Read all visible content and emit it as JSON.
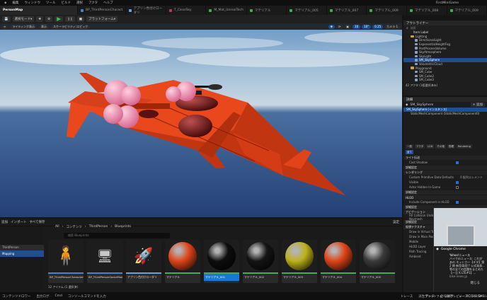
{
  "menu": [
    "編集",
    "ウィンドウ",
    "ツール",
    "ビルド",
    "選択",
    "アクタ",
    "ヘルプ"
  ],
  "project_name": "FirstMiniGame",
  "level_name": "PersonMap",
  "tabs": [
    {
      "label": "BP_ThirdPersonCharact",
      "color": "#4a7fd4"
    },
    {
      "label": "アプリン色付けローダリ",
      "color": "#6aa0e0"
    },
    {
      "label": "T_ClearSky",
      "color": "#c0364b"
    },
    {
      "label": "M_Mat_UnrealTech",
      "color": "#3fae5a"
    },
    {
      "label": "マテリアル",
      "color": "#3fae5a"
    },
    {
      "label": "マテリアル_005",
      "color": "#3fae5a"
    },
    {
      "label": "マテリアル_007",
      "color": "#3fae5a"
    },
    {
      "label": "マテリアル_009",
      "color": "#3fae5a"
    },
    {
      "label": "マテリアル_008",
      "color": "#3fae5a"
    },
    {
      "label": "マテリアル_009",
      "color": "#3fae5a"
    }
  ],
  "toolbar": {
    "mode": "選択モード",
    "platforms": "プラットフォーム"
  },
  "viewport": {
    "left": [
      "ライティング表示",
      "表示",
      "スケーラビリティ:エピック"
    ],
    "right": [
      "10",
      "10°",
      "0.25",
      "カメラ 1"
    ],
    "label": "プラットフォームのプレビュー: PC D3D SM5"
  },
  "outliner": {
    "title": "アウトライナー",
    "search": "検索",
    "column": "Item Label",
    "items": [
      {
        "label": "Lighting",
        "type": "folder",
        "indent": 1,
        "selected": false
      },
      {
        "label": "DirectionalLight",
        "type": "obj",
        "indent": 2,
        "selected": false
      },
      {
        "label": "ExponentialHeightFog",
        "type": "obj",
        "indent": 2,
        "selected": false
      },
      {
        "label": "PostProcessVolume",
        "type": "obj",
        "indent": 2,
        "selected": false
      },
      {
        "label": "SkyAtmosphere",
        "type": "obj",
        "indent": 2,
        "selected": false
      },
      {
        "label": "SkyLight",
        "type": "obj",
        "indent": 2,
        "selected": false
      },
      {
        "label": "SM_SkySphere",
        "type": "obj",
        "indent": 2,
        "selected": true
      },
      {
        "label": "VolumetricCloud",
        "type": "obj",
        "indent": 2,
        "selected": false
      },
      {
        "label": "Playground",
        "type": "folder",
        "indent": 1,
        "selected": false
      },
      {
        "label": "SM_Cube",
        "type": "obj",
        "indent": 2,
        "selected": false
      },
      {
        "label": "SM_Cube2",
        "type": "obj",
        "indent": 2,
        "selected": false
      },
      {
        "label": "SM_Cube3",
        "type": "obj",
        "indent": 2,
        "selected": false
      }
    ],
    "footer": "42 アクタ (1個選択済み)"
  },
  "details": {
    "title": "詳細",
    "actor": "SM_SkySphere",
    "add": "+ 追加",
    "instance": "SM_SkySphere (インスタンス)",
    "component": "StaticMeshComponent (StaticMeshComponent0)",
    "filters": [
      "一般",
      "アクタ",
      "LOD",
      "その他",
      "物理",
      "Rendering"
    ],
    "all": "全て",
    "sections": [
      {
        "title": "ライト伝送",
        "props": [
          {
            "label": "Cast Shadow",
            "checked": true
          }
        ]
      },
      {
        "title": "詳細設定",
        "props": []
      },
      {
        "title": "レンダリング",
        "props": [
          {
            "label": "Custom Primitive Data Defaults",
            "value": "0 配列エレメント",
            "checked": null
          },
          {
            "label": "Visible",
            "checked": true
          },
          {
            "label": "Actor Hidden In Game",
            "checked": false
          }
        ]
      },
      {
        "title": "詳細設定",
        "props": []
      },
      {
        "title": "HLOD",
        "props": [
          {
            "label": "Include Component in HLOD",
            "checked": true
          }
        ]
      },
      {
        "title": "詳細設定",
        "props": []
      },
      {
        "title": "ナビゲーション",
        "props": [
          {
            "label": "Fill Collision Underneath for Navmesh",
            "checked": false
          }
        ]
      },
      {
        "title": "詳細設定",
        "props": []
      },
      {
        "title": "仮想テクスチャ",
        "props": [
          {
            "label": "Draw in Virtual Textures",
            "checked": false
          },
          {
            "label": "Draw in Main Pass",
            "checked": true
          }
        ]
      }
    ],
    "extra": [
      "Mobile",
      "HLOD Layer",
      "Path Tracing",
      "Ambient"
    ]
  },
  "content_browser": {
    "actions": [
      "追加",
      "インポート",
      "すべて保存"
    ],
    "path": [
      "All",
      "コンテンツ",
      "ThirdPerson",
      "Blueprints"
    ],
    "search": "検索 Blueprints",
    "folders": [
      "",
      "",
      "",
      "ThirdPerson",
      "Mapping",
      ""
    ],
    "settings": "設定",
    "assets": [
      {
        "name": "BP_ThirdPersonCharacter",
        "kind": "char",
        "color": "#4a7fd4",
        "selected": false
      },
      {
        "name": "BP_ThirdPersonGameMode",
        "kind": "mode",
        "color": "#4a7fd4",
        "selected": false
      },
      {
        "name": "アプリン色付けローダリ",
        "kind": "ship",
        "color": "#6aa0e0",
        "selected": false
      },
      {
        "name": "マテリアル",
        "kind": "sphere",
        "sphere": "#e04418",
        "color": "#3fae5a",
        "selected": false
      },
      {
        "name": "マテリアル_001",
        "kind": "sphere",
        "sphere": "#0d0d0d",
        "color": "#3fae5a",
        "selected": true
      },
      {
        "name": "マテリアル_002",
        "kind": "sphere",
        "sphere": "#141414",
        "color": "#3fae5a",
        "selected": false
      },
      {
        "name": "マテリアル_003",
        "kind": "sphere",
        "sphere": "#bdb21a",
        "color": "#3fae5a",
        "selected": false
      },
      {
        "name": "マテリアル_004",
        "kind": "sphere",
        "sphere": "#e04418",
        "color": "#3fae5a",
        "selected": false
      },
      {
        "name": "マテリアル_005",
        "kind": "sphere",
        "sphere": "#3a3a3a",
        "color": "#3fae5a",
        "selected": false
      }
    ],
    "count": "12 アイテム (1 選択済)"
  },
  "status": [
    "コンテンツドロワー",
    "出力ログ",
    "Cmd",
    "コンソールコマンドを入力",
    "トレース",
    "派生データ",
    "全て保存",
    "ソースコントロール"
  ],
  "notification": {
    "app": "Google Chrome",
    "title": "Yahoo!ニュース",
    "body": "バイクのニュース: これがあの ネットカー【キタ】第2 期 新型車両!? 公式発表...等の全ての話題をまとめた 【一旦 K LTE#1】...",
    "site": "bike-news.jp",
    "close": "閉じる"
  }
}
